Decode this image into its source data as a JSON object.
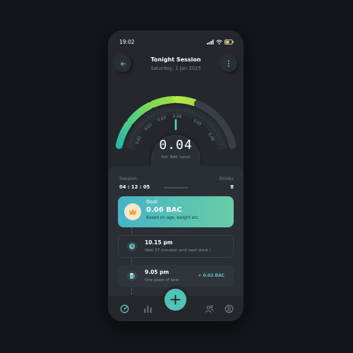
{
  "status_bar": {
    "time": "19:02"
  },
  "header": {
    "title": "Tonight Session",
    "subtitle": "Saturday, 1 Jan 2025"
  },
  "gauge": {
    "tick_labels": [
      "0.01",
      "0.02",
      "0.03",
      "0.04",
      "0.05",
      "0.06"
    ],
    "bac_value": "0.04",
    "bac_label": "Est. BAC Level",
    "level_fraction": 0.5,
    "colors": {
      "teal": "#3fbfa8",
      "green": "#7ed957",
      "lime": "#b8e64a",
      "inactive": "#3a3f46"
    }
  },
  "session": {
    "label": "Session",
    "time": "04 : 12 : 05"
  },
  "drinks": {
    "label": "Drinks",
    "count": "8"
  },
  "goal": {
    "label": "Goal",
    "value": "0.06 BAC",
    "description": "Based on age, weight etc."
  },
  "entries": [
    {
      "time": "10.15 pm",
      "description": "Wait  37 minutes until next drink !",
      "icon": "clock-icon"
    },
    {
      "time": "9.05 pm",
      "description": "One glass of beer",
      "bac_change": "+ 0.02 BAC",
      "icon": "beer-icon"
    }
  ],
  "nav": {
    "items": [
      "home-icon",
      "stats-icon",
      "add-icon",
      "friends-icon",
      "profile-icon"
    ]
  }
}
